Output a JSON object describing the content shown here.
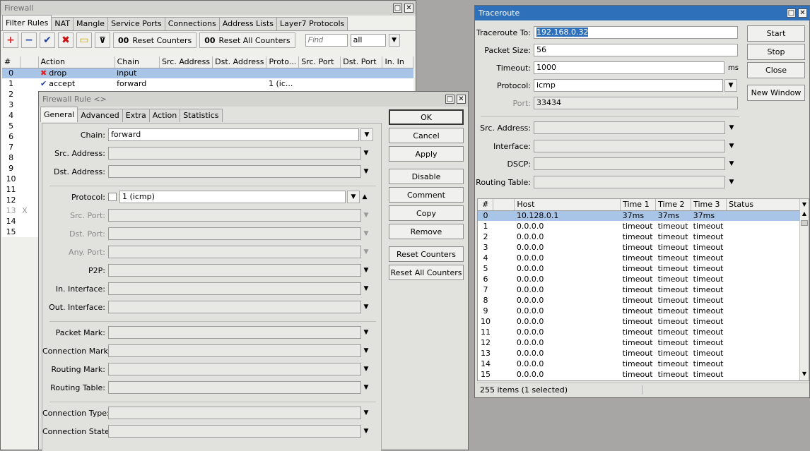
{
  "firewall": {
    "title": "Firewall",
    "tabs": [
      "Filter Rules",
      "NAT",
      "Mangle",
      "Service Ports",
      "Connections",
      "Address Lists",
      "Layer7 Protocols"
    ],
    "toolbar": {
      "reset_counters": "Reset Counters",
      "reset_all_counters": "Reset All Counters",
      "find_placeholder": "Find",
      "filter_value": "all",
      "oo": "00"
    },
    "columns": [
      "#",
      "",
      "Action",
      "Chain",
      "Src. Address",
      "Dst. Address",
      "Proto...",
      "Src. Port",
      "Dst. Port",
      "In. In"
    ],
    "rows": [
      {
        "num": "0",
        "action": "drop",
        "chain": "input",
        "proto": ""
      },
      {
        "num": "1",
        "action": "accept",
        "chain": "forward",
        "proto": "1 (ic..."
      }
    ],
    "row_numbers": [
      "2",
      "3",
      "4",
      "5",
      "6",
      "7",
      "8",
      "9",
      "10",
      "11",
      "12",
      "13",
      "14",
      "15"
    ],
    "disabled_marker": "X"
  },
  "rule": {
    "title": "Firewall Rule <>",
    "tabs": [
      "General",
      "Advanced",
      "Extra",
      "Action",
      "Statistics"
    ],
    "fields": {
      "chain_label": "Chain:",
      "chain_value": "forward",
      "src_address": "Src. Address:",
      "dst_address": "Dst. Address:",
      "protocol_label": "Protocol:",
      "protocol_value": "1 (icmp)",
      "src_port": "Src. Port:",
      "dst_port": "Dst. Port:",
      "any_port": "Any. Port:",
      "p2p": "P2P:",
      "in_interface": "In. Interface:",
      "out_interface": "Out. Interface:",
      "packet_mark": "Packet Mark:",
      "connection_mark": "Connection Mark:",
      "routing_mark": "Routing Mark:",
      "routing_table": "Routing Table:",
      "connection_type": "Connection Type:",
      "connection_state": "Connection State:"
    },
    "buttons": [
      "OK",
      "Cancel",
      "Apply",
      "Disable",
      "Comment",
      "Copy",
      "Remove",
      "Reset Counters",
      "Reset All Counters"
    ]
  },
  "traceroute": {
    "title": "Traceroute",
    "labels": {
      "to": "Traceroute To:",
      "packet_size": "Packet Size:",
      "timeout": "Timeout:",
      "protocol": "Protocol:",
      "port": "Port:",
      "src_address": "Src. Address:",
      "interface": "Interface:",
      "dscp": "DSCP:",
      "routing_table": "Routing Table:"
    },
    "values": {
      "to": "192.168.0.32",
      "packet_size": "56",
      "timeout": "1000",
      "timeout_unit": "ms",
      "protocol": "icmp",
      "port": "33434"
    },
    "buttons": [
      "Start",
      "Stop",
      "Close",
      "New Window"
    ],
    "columns": [
      "#",
      "Host",
      "Time 1",
      "Time 2",
      "Time 3",
      "Status"
    ],
    "rows": [
      [
        "0",
        "10.128.0.1",
        "37ms",
        "37ms",
        "37ms"
      ],
      [
        "1",
        "0.0.0.0",
        "timeout",
        "timeout",
        "timeout"
      ],
      [
        "2",
        "0.0.0.0",
        "timeout",
        "timeout",
        "timeout"
      ],
      [
        "3",
        "0.0.0.0",
        "timeout",
        "timeout",
        "timeout"
      ],
      [
        "4",
        "0.0.0.0",
        "timeout",
        "timeout",
        "timeout"
      ],
      [
        "5",
        "0.0.0.0",
        "timeout",
        "timeout",
        "timeout"
      ],
      [
        "6",
        "0.0.0.0",
        "timeout",
        "timeout",
        "timeout"
      ],
      [
        "7",
        "0.0.0.0",
        "timeout",
        "timeout",
        "timeout"
      ],
      [
        "8",
        "0.0.0.0",
        "timeout",
        "timeout",
        "timeout"
      ],
      [
        "9",
        "0.0.0.0",
        "timeout",
        "timeout",
        "timeout"
      ],
      [
        "10",
        "0.0.0.0",
        "timeout",
        "timeout",
        "timeout"
      ],
      [
        "11",
        "0.0.0.0",
        "timeout",
        "timeout",
        "timeout"
      ],
      [
        "12",
        "0.0.0.0",
        "timeout",
        "timeout",
        "timeout"
      ],
      [
        "13",
        "0.0.0.0",
        "timeout",
        "timeout",
        "timeout"
      ],
      [
        "14",
        "0.0.0.0",
        "timeout",
        "timeout",
        "timeout"
      ],
      [
        "15",
        "0.0.0.0",
        "timeout",
        "timeout",
        "timeout"
      ]
    ],
    "status": "255 items (1 selected)"
  }
}
